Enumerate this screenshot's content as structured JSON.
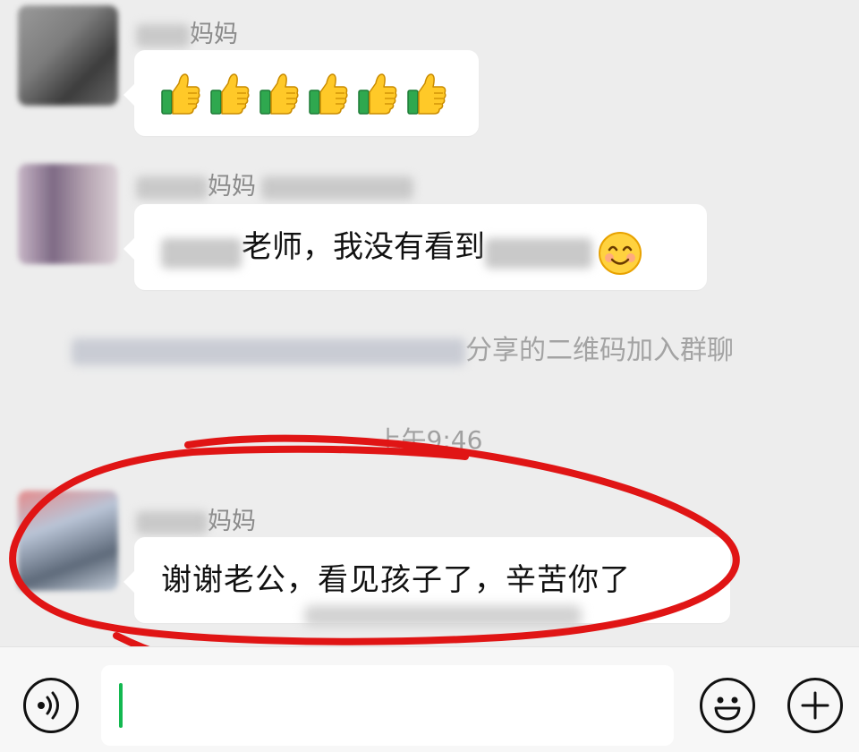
{
  "messages": [
    {
      "sender_suffix": "妈妈",
      "type": "emoji",
      "emoji_icons": [
        "thumbs-up-icon",
        "thumbs-up-icon",
        "thumbs-up-icon",
        "thumbs-up-icon",
        "thumbs-up-icon",
        "thumbs-up-icon"
      ]
    },
    {
      "sender_suffix": "妈妈",
      "type": "text",
      "text_visible": "老师，我没有看到",
      "trailing_icon": "smile-emoji-icon"
    }
  ],
  "system_notice": {
    "text_visible": "分享的二维码加入群聊"
  },
  "timestamp": "上午9:46",
  "highlighted_message": {
    "sender_suffix": "妈妈",
    "text": "谢谢老公，看见孩子了，辛苦你了"
  },
  "annotation": {
    "color": "#e01515",
    "shape": "hand-drawn-ellipse"
  },
  "input_bar": {
    "left_icon": "voice-icon",
    "right_icons": [
      "emoji-icon",
      "plus-icon"
    ],
    "caret_color": "#13b850"
  }
}
